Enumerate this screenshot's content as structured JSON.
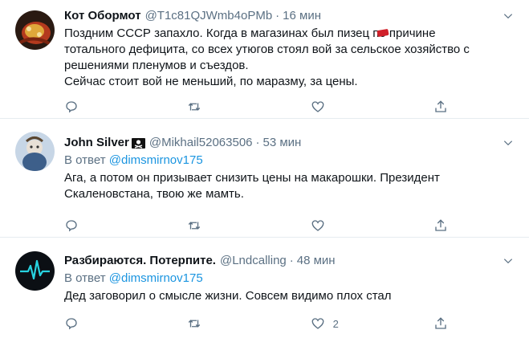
{
  "tweets": [
    {
      "name": "Кот Обормот",
      "handle": "@T1c81QJWmb4oPMb",
      "time": "16 мин",
      "text_lines": [
        "Поздним СССР запахло. Когда в магазинах был пизец по причине",
        "тотального дефицита, со всех утюгов стоял вой за сельское хозяйство с",
        "решениями пленумов и съездов.",
        "Сейчас стоит вой не меньший, по маразму, за цены."
      ]
    },
    {
      "name": "John Silver",
      "handle": "@Mikhail52063506",
      "time": "53 мин",
      "reply_prefix": "В ответ",
      "reply_mention": "@dimsmirnov175",
      "text_lines": [
        "Ага, а потом он призывает снизить цены на макарошки. Президент",
        "Скаленовстана, твою же мамть."
      ]
    },
    {
      "name": "Разбираются. Потерпите.",
      "handle": "@Lndcalling",
      "time": "48 мин",
      "reply_prefix": "В ответ",
      "reply_mention": "@dimsmirnov175",
      "text_lines": [
        "Дед заговорил о смысле жизни. Совсем видимо плох стал"
      ],
      "like_count": "2"
    }
  ],
  "separator": "·",
  "icons": {
    "reply": "reply-icon",
    "retweet": "retweet-icon",
    "like": "like-icon",
    "share": "share-icon",
    "more": "chevron-down-icon"
  },
  "colors": {
    "secondary_text": "#5b7083",
    "link": "#1b95e0",
    "divider": "#e6ecf0"
  }
}
